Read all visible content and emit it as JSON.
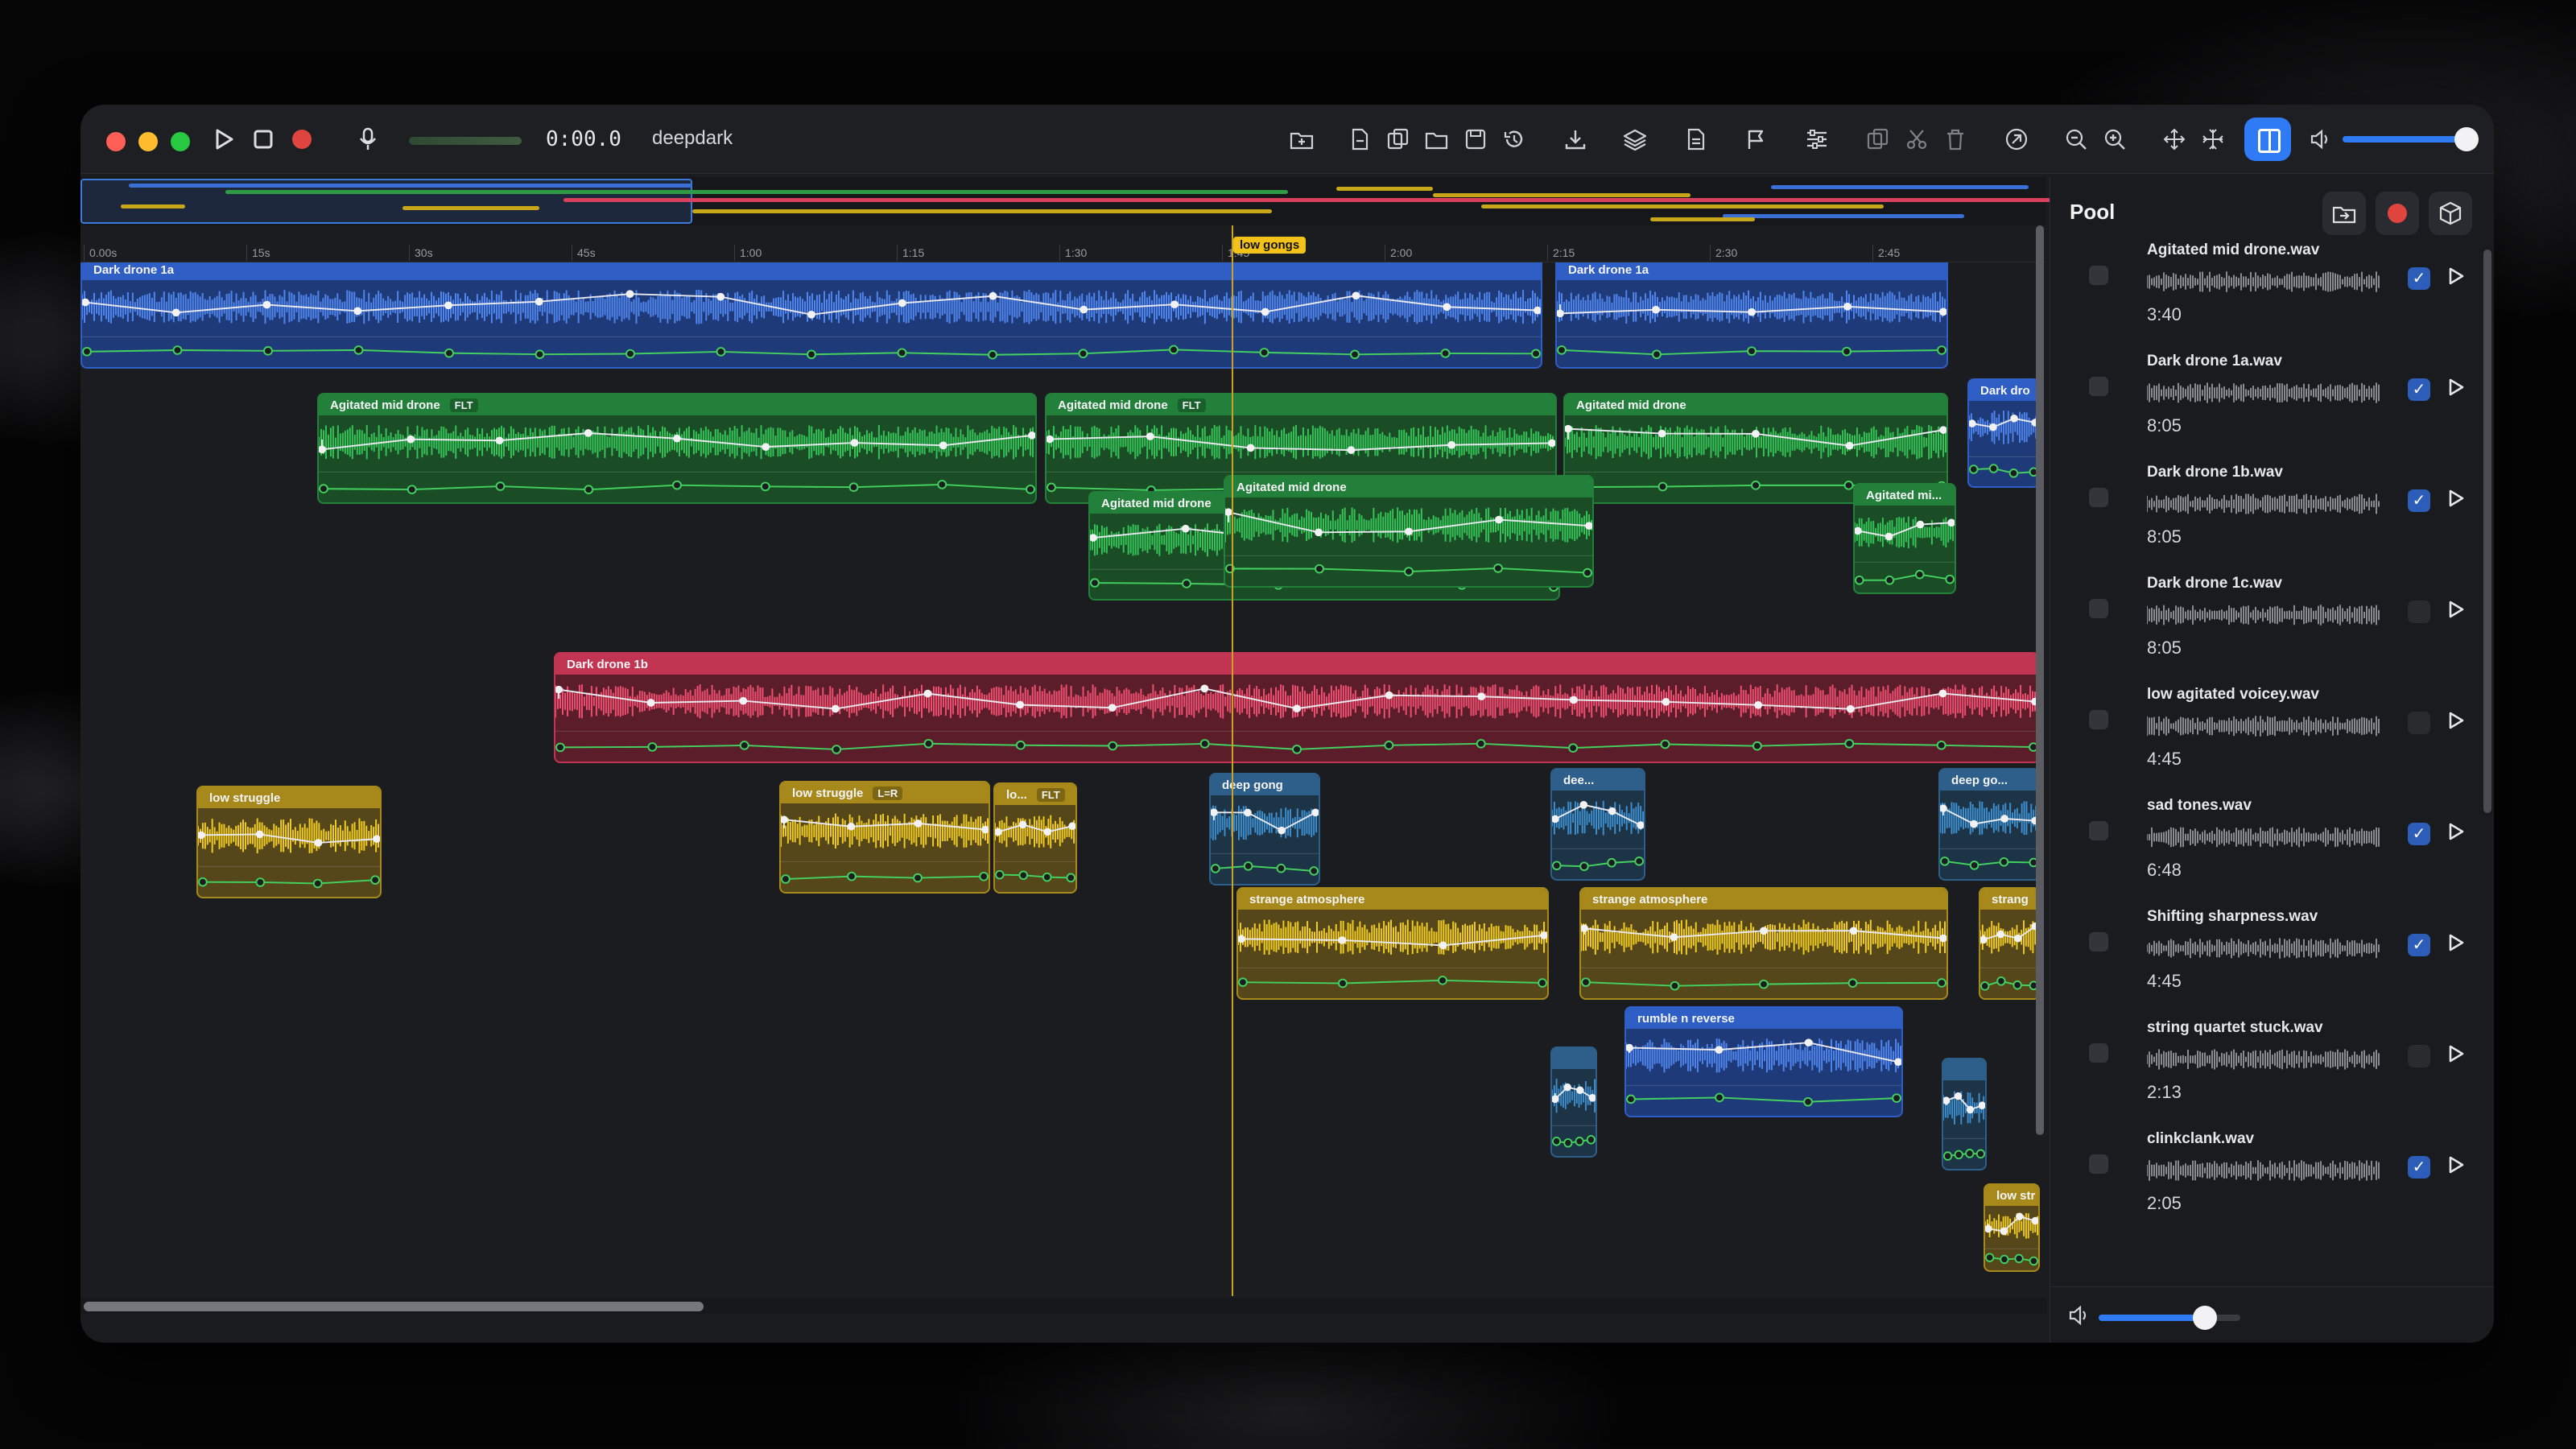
{
  "toolbar": {
    "time": "0:00.0",
    "project_name": "deepdark",
    "icons": [
      "play-icon",
      "stop-icon",
      "record-icon",
      "microphone-icon",
      "import-folder-icon",
      "new-file-icon",
      "duplicate-icon",
      "open-folder-icon",
      "save-icon",
      "history-icon",
      "download-icon",
      "layers-icon",
      "document-icon",
      "flag-icon",
      "mixer-icon",
      "copy-icon",
      "scissors-icon",
      "trash-icon",
      "link-icon",
      "zoom-out-icon",
      "zoom-in-icon",
      "expand-icon",
      "collapse-icon",
      "split-view-icon",
      "volume-icon"
    ],
    "volume": 0.93
  },
  "ruler": {
    "ticks": [
      "0.00s",
      "15s",
      "30s",
      "45s",
      "1:00",
      "1:15",
      "1:30",
      "1:45",
      "2:00",
      "2:15",
      "2:30",
      "2:45"
    ],
    "marker": "low gongs"
  },
  "colors": {
    "blue": "#3a6fd6",
    "green": "#2f9b45",
    "red": "#d8415d",
    "yellow": "#c8a619",
    "accent": "#2f7bf5"
  },
  "clips": [
    {
      "label": "Dark drone 1a",
      "color": "blue"
    },
    {
      "label": "Dark drone 1a",
      "color": "blue"
    },
    {
      "label": "Dark dro",
      "color": "blue"
    },
    {
      "label": "Agitated mid drone",
      "tag": "FLT",
      "color": "green"
    },
    {
      "label": "Agitated mid drone",
      "tag": "FLT",
      "color": "green"
    },
    {
      "label": "Agitated mid drone",
      "color": "green"
    },
    {
      "label": "Agitated mid drone",
      "color": "green"
    },
    {
      "label": "Agitated mid drone",
      "color": "green"
    },
    {
      "label": "Agitated mi...",
      "color": "green"
    },
    {
      "label": "Dark drone 1b",
      "color": "red"
    },
    {
      "label": "low struggle",
      "color": "yellow"
    },
    {
      "label": "low struggle",
      "tag": "L=R",
      "color": "yellow"
    },
    {
      "label": "lo...",
      "tag": "FLT",
      "color": "yellow"
    },
    {
      "label": "deep gong",
      "color": "steel"
    },
    {
      "label": "dee...",
      "color": "steel"
    },
    {
      "label": "deep go...",
      "color": "steel"
    },
    {
      "label": "strange atmosphere",
      "color": "yellow"
    },
    {
      "label": "strange atmosphere",
      "color": "yellow"
    },
    {
      "label": "strang",
      "color": "yellow"
    },
    {
      "label": "rumble n reverse",
      "color": "blue"
    },
    {
      "label": "",
      "color": "steel"
    },
    {
      "label": "",
      "color": "steel"
    },
    {
      "label": "low str",
      "color": "yellow"
    }
  ],
  "pool": {
    "title": "Pool",
    "items": [
      {
        "name": "Agitated mid drone.wav",
        "duration": "3:40",
        "enabled": true
      },
      {
        "name": "Dark drone 1a.wav",
        "duration": "8:05",
        "enabled": true
      },
      {
        "name": "Dark drone 1b.wav",
        "duration": "8:05",
        "enabled": true
      },
      {
        "name": "Dark drone 1c.wav",
        "duration": "8:05",
        "enabled": false
      },
      {
        "name": "low agitated voicey.wav",
        "duration": "4:45",
        "enabled": false
      },
      {
        "name": "sad tones.wav",
        "duration": "6:48",
        "enabled": true
      },
      {
        "name": "Shifting sharpness.wav",
        "duration": "4:45",
        "enabled": true
      },
      {
        "name": "string quartet stuck.wav",
        "duration": "2:13",
        "enabled": false
      },
      {
        "name": "clinkclank.wav",
        "duration": "2:05",
        "enabled": true
      }
    ],
    "volume": 0.75
  }
}
